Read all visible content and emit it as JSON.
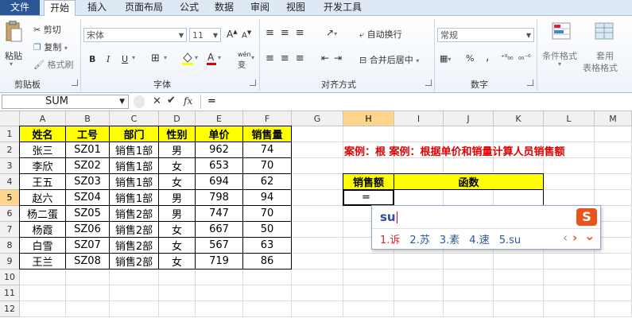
{
  "tabs": [
    "文件",
    "开始",
    "插入",
    "页面布局",
    "公式",
    "数据",
    "审阅",
    "视图",
    "开发工具"
  ],
  "ribbon": {
    "clipboard": {
      "paste": "粘贴",
      "cut": "剪切",
      "copy": "复制",
      "format_painter": "格式刷",
      "label": "剪贴板"
    },
    "font": {
      "name": "宋体",
      "size": "11",
      "grow": "A",
      "shrink": "A",
      "bold": "B",
      "italic": "I",
      "underline": "U",
      "wen": "wén",
      "label": "字体"
    },
    "align": {
      "wrap": "自动换行",
      "merge": "合并后居中",
      "label": "对齐方式"
    },
    "number": {
      "format": "常规",
      "percent": "%",
      "comma": ",",
      "label": "数字"
    },
    "styles": {
      "cond_format": "条件格式",
      "table_fmt_1": "套用",
      "table_fmt_2": "表格格式"
    }
  },
  "formula_bar": {
    "name_box": "SUM",
    "cancel": "✕",
    "enter": "✔",
    "fx": "fx",
    "content": "="
  },
  "columns": [
    "A",
    "B",
    "C",
    "D",
    "E",
    "F",
    "G",
    "H",
    "I",
    "J",
    "K",
    "L",
    "M"
  ],
  "rows": [
    "1",
    "2",
    "3",
    "4",
    "5",
    "6",
    "7",
    "8",
    "9",
    "10",
    "11",
    "12"
  ],
  "table": {
    "headers": [
      "姓名",
      "工号",
      "部门",
      "性别",
      "单价",
      "销售量"
    ],
    "data": [
      [
        "张三",
        "SZ01",
        "销售1部",
        "男",
        "962",
        "74"
      ],
      [
        "李欣",
        "SZ02",
        "销售1部",
        "女",
        "653",
        "70"
      ],
      [
        "王五",
        "SZ03",
        "销售1部",
        "女",
        "694",
        "62"
      ],
      [
        "赵六",
        "SZ04",
        "销售1部",
        "男",
        "798",
        "94"
      ],
      [
        "杨二蛋",
        "SZ05",
        "销售2部",
        "男",
        "747",
        "70"
      ],
      [
        "杨霞",
        "SZ06",
        "销售2部",
        "女",
        "667",
        "50"
      ],
      [
        "白雪",
        "SZ07",
        "销售2部",
        "女",
        "567",
        "63"
      ],
      [
        "王兰",
        "SZ08",
        "销售2部",
        "女",
        "719",
        "86"
      ]
    ]
  },
  "example_text": "案例：根 案例：根据单价和销量计算人员销售额",
  "calc_table": {
    "h_sales": "销售额",
    "h_func": "函数",
    "cell_value": "="
  },
  "ime": {
    "input": "su",
    "candidates": [
      {
        "num": "1.",
        "ch": "诉"
      },
      {
        "num": "2.",
        "ch": "苏"
      },
      {
        "num": "3.",
        "ch": "素"
      },
      {
        "num": "4.",
        "ch": "速"
      },
      {
        "num": "5.",
        "ch": "su"
      }
    ],
    "prev": "‹",
    "next": "›",
    "more": "⌄",
    "logo": "S"
  }
}
